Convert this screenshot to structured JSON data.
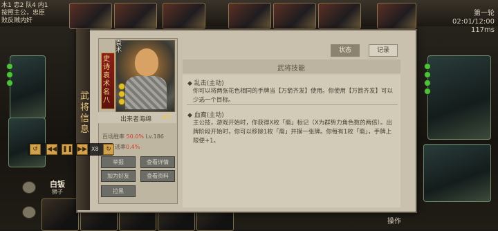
{
  "top": {
    "top_left_lines": [
      "木1 忠2 队4 内1",
      "按照主公，忠臣",
      "败反贼内奸"
    ],
    "round_label": "第一轮",
    "time_label": "02:01/12:00",
    "ping_label": "117ms"
  },
  "panel": {
    "side_title": "武将信息",
    "hero": {
      "name_vertical": "史诗袁术名八",
      "tag": "袁术",
      "level_badge": "v7",
      "title_line": "出来者海绵",
      "stat_winrate_label": "百场胜率",
      "stat_winrate_value": "50.0%",
      "stat_lv": "Lv.186",
      "stat_escape_label": "逃率",
      "stat_escape_value": "0.4%",
      "buttons": [
        "举报",
        "查看详情",
        "加为好友",
        "查看资料",
        "拉黑"
      ]
    },
    "tabs": {
      "status": "状态",
      "record": "记录"
    },
    "skill_section_title": "武将技能",
    "skills": [
      {
        "name": "乱击(主动)",
        "text": "你可以将两张花色相同的手牌当【万箭齐发】使用。你使用【万箭齐发】可以少选一个目标。"
      },
      {
        "name": "血裔(主动)",
        "text": "主公技，游戏开始时，你获得X枚「裔」标记（X为群势力角色数的两倍）。出牌阶段开始时，你可以移除1枚「裔」并摸一张牌。你每有1枚「裔」，手牌上限便+1。"
      }
    ]
  },
  "replay": {
    "speed": "X8"
  },
  "left_player": {
    "name": "白钣",
    "sub": "狮子"
  },
  "bottom": {
    "right_label": "操作"
  }
}
